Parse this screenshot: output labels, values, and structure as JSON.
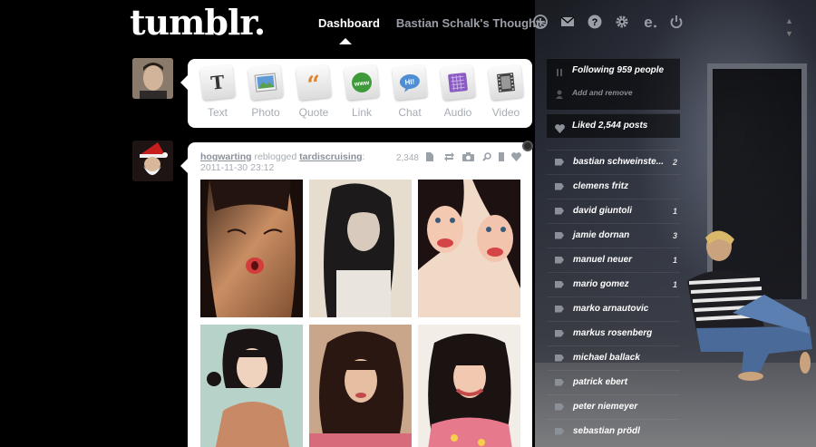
{
  "header": {
    "logo": "tumblr.",
    "nav_dashboard": "Dashboard",
    "nav_blog": "Bastian Schalk's Thoughts",
    "icons": [
      "plus-circle-icon",
      "mail-icon",
      "help-icon",
      "gear-icon",
      "e-icon",
      "power-icon"
    ]
  },
  "composer": {
    "types": [
      {
        "label": "Text",
        "icon": "text-icon",
        "color": "#333333"
      },
      {
        "label": "Photo",
        "icon": "photo-icon",
        "color": "#4a8fc9"
      },
      {
        "label": "Quote",
        "icon": "quote-icon",
        "color": "#e0822a"
      },
      {
        "label": "Link",
        "icon": "link-icon",
        "color": "#3f9a3c"
      },
      {
        "label": "Chat",
        "icon": "chat-icon",
        "color": "#4f8ed2"
      },
      {
        "label": "Audio",
        "icon": "audio-icon",
        "color": "#8a5bc2"
      },
      {
        "label": "Video",
        "icon": "video-icon",
        "color": "#555555"
      }
    ]
  },
  "post": {
    "user": "hogwarting",
    "action": "reblogged",
    "source": "tardiscruising",
    "colon": ":",
    "timestamp": "2011-11-30 23:12",
    "notes": "2,348"
  },
  "sidebar": {
    "following": "Following 959 people",
    "add_remove": "Add and remove",
    "liked": "Liked 2,544 posts",
    "tags": [
      {
        "name": "bastian schweinste...",
        "count": "2"
      },
      {
        "name": "clemens fritz",
        "count": ""
      },
      {
        "name": "david giuntoli",
        "count": "1"
      },
      {
        "name": "jamie dornan",
        "count": "3"
      },
      {
        "name": "manuel neuer",
        "count": "1"
      },
      {
        "name": "mario gomez",
        "count": "1"
      },
      {
        "name": "marko arnautovic",
        "count": ""
      },
      {
        "name": "markus rosenberg",
        "count": ""
      },
      {
        "name": "michael ballack",
        "count": ""
      },
      {
        "name": "patrick ebert",
        "count": ""
      },
      {
        "name": "peter niemeyer",
        "count": ""
      },
      {
        "name": "sebastian prödl",
        "count": ""
      }
    ]
  }
}
